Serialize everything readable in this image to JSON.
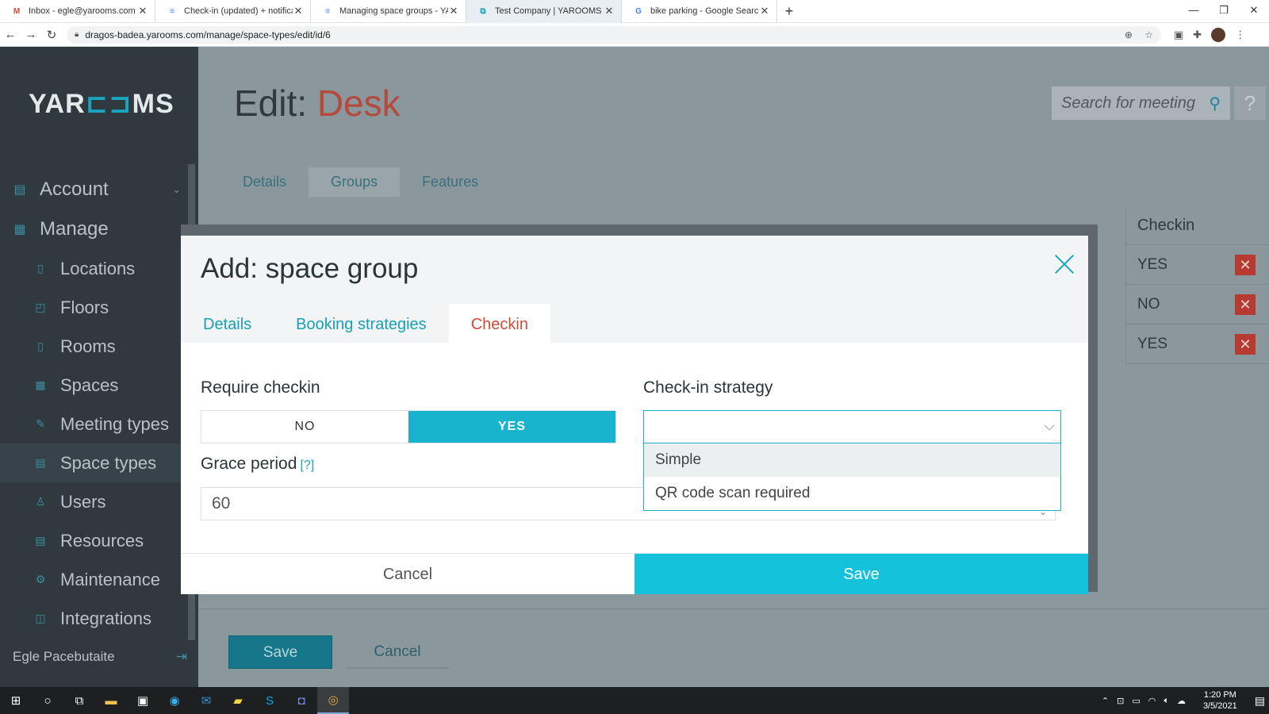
{
  "browser": {
    "tabs": [
      {
        "title": "Inbox - egle@yarooms.com - YA",
        "favicon": "M",
        "favicon_color": "#d44638"
      },
      {
        "title": "Check-in (updated) + notification",
        "favicon": "≡",
        "favicon_color": "#4285f4"
      },
      {
        "title": "Managing space groups - YARO",
        "favicon": "≡",
        "favicon_color": "#4285f4"
      },
      {
        "title": "Test Company | YAROOMS",
        "favicon": "⧉",
        "favicon_color": "#1aa6bf"
      },
      {
        "title": "bike parking - Google Search",
        "favicon": "G",
        "favicon_color": "#4285f4"
      }
    ],
    "url": "dragos-badea.yarooms.com/manage/space-types/edit/id/6"
  },
  "sidebar": {
    "logo_left": "YAR",
    "logo_mid": "⊏⊐",
    "logo_right": "MS",
    "items": [
      {
        "label": "Account",
        "name": "account",
        "icon": "▤",
        "level": "top",
        "chevron": "⌄"
      },
      {
        "label": "Manage",
        "name": "manage",
        "icon": "▦",
        "level": "top"
      },
      {
        "label": "Locations",
        "name": "locations",
        "icon": "▯",
        "level": "sub"
      },
      {
        "label": "Floors",
        "name": "floors",
        "icon": "◰",
        "level": "sub"
      },
      {
        "label": "Rooms",
        "name": "rooms",
        "icon": "▯",
        "level": "sub"
      },
      {
        "label": "Spaces",
        "name": "spaces",
        "icon": "▦",
        "level": "sub"
      },
      {
        "label": "Meeting types",
        "name": "meeting-types",
        "icon": "✎",
        "level": "sub"
      },
      {
        "label": "Space types",
        "name": "space-types",
        "icon": "▤",
        "level": "sub",
        "active": true
      },
      {
        "label": "Users",
        "name": "users",
        "icon": "♙",
        "level": "sub"
      },
      {
        "label": "Resources",
        "name": "resources",
        "icon": "▤",
        "level": "sub"
      },
      {
        "label": "Maintenance",
        "name": "maintenance",
        "icon": "⚙",
        "level": "sub"
      },
      {
        "label": "Integrations",
        "name": "integrations",
        "icon": "◫",
        "level": "sub"
      }
    ],
    "user_name": "Egle Pacebutaite"
  },
  "page": {
    "title_prefix": "Edit:",
    "title_name": "Desk",
    "search_placeholder": "Search for meeting",
    "help": "?",
    "bg_tabs": [
      "Details",
      "Groups",
      "Features"
    ],
    "table_header": "Checkin",
    "table_rows": [
      "YES",
      "NO",
      "YES"
    ],
    "save_label": "Save",
    "cancel_label": "Cancel"
  },
  "modal": {
    "title": "Add: space group",
    "tabs": [
      "Details",
      "Booking strategies",
      "Checkin"
    ],
    "active_tab": "Checkin",
    "require_checkin_label": "Require checkin",
    "toggle_no": "NO",
    "toggle_yes": "YES",
    "toggle_value": "YES",
    "grace_label": "Grace period",
    "grace_hint": "[?]",
    "grace_value": "60",
    "strategy_label": "Check-in strategy",
    "strategy_value": "",
    "strategy_options": [
      "Simple",
      "QR code scan required"
    ],
    "highlighted_option": "Simple",
    "cancel_label": "Cancel",
    "save_label": "Save"
  },
  "taskbar": {
    "time": "1:20 PM",
    "date": "3/5/2021"
  },
  "colors": {
    "accent": "#18b3cc",
    "active_tab": "#d24c3c",
    "sidebar": "#2f393e"
  }
}
